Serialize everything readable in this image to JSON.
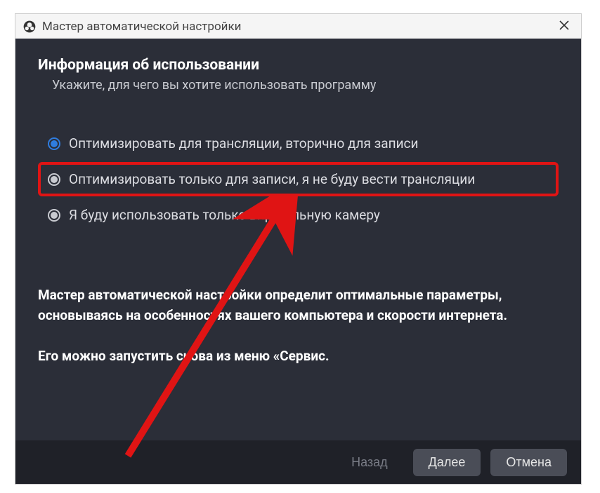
{
  "window": {
    "title": "Мастер автоматической настройки"
  },
  "header": {
    "title": "Информация об использовании",
    "subtitle": "Укажите, для чего вы хотите использовать программу"
  },
  "options": [
    {
      "label": "Оптимизировать для трансляции, вторично для записи",
      "selected": true,
      "highlighted": false
    },
    {
      "label": "Оптимизировать только для записи, я не буду вести трансляции",
      "selected": false,
      "highlighted": true
    },
    {
      "label": "Я буду использовать только виртуальную камеру",
      "selected": false,
      "highlighted": false
    }
  ],
  "description": {
    "line1": "Мастер автоматической настройки определит оптимальные параметры, основываясь на особенностях вашего компьютера и скорости интернета.",
    "line2": "Его можно запустить снова из меню «Сервис."
  },
  "buttons": {
    "back": "Назад",
    "next": "Далее",
    "cancel": "Отмена"
  },
  "annotation": {
    "color": "#e01414"
  }
}
